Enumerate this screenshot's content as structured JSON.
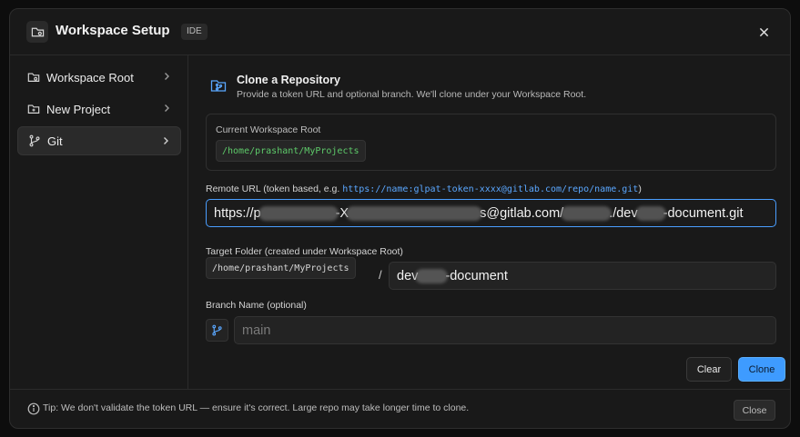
{
  "header": {
    "title": "Workspace Setup",
    "badge": "IDE"
  },
  "sidebar": {
    "items": [
      {
        "label": "Workspace Root",
        "icon": "folder-gear-icon",
        "active": false
      },
      {
        "label": "New Project",
        "icon": "folder-plus-icon",
        "active": false
      },
      {
        "label": "Git",
        "icon": "git-branch-icon",
        "active": true
      }
    ]
  },
  "main": {
    "section_title": "Clone a Repository",
    "section_subtitle": "Provide a token URL and optional branch. We'll clone under your Workspace Root.",
    "current_root": {
      "label": "Current Workspace Root",
      "path": "/home/prashant/MyProjects"
    },
    "remote_url": {
      "label": "Remote URL (token based, e.g. ",
      "example": "https://name:glpat-token-xxxx@gitlab.com/repo/name.git",
      "label_end": ")",
      "value_parts": [
        "https://p",
        "-X",
        "s@gitlab.com/",
        "./dev",
        "-document.git"
      ]
    },
    "target_folder": {
      "label": "Target Folder (created under Workspace Root)",
      "prefix": "/home/prashant/MyProjects",
      "separator": "/",
      "value_parts": [
        "dev",
        "-document"
      ]
    },
    "branch": {
      "label": "Branch Name (optional)",
      "placeholder": "main"
    },
    "buttons": {
      "clear": "Clear",
      "clone": "Clone"
    }
  },
  "footer": {
    "tip": "Tip: We don't validate the token URL — ensure it's correct. Large repo may take longer time to clone.",
    "close": "Close"
  },
  "colors": {
    "accent": "#3e9bff",
    "path_green": "#5ecb6a",
    "link_blue": "#5aa7ff"
  }
}
